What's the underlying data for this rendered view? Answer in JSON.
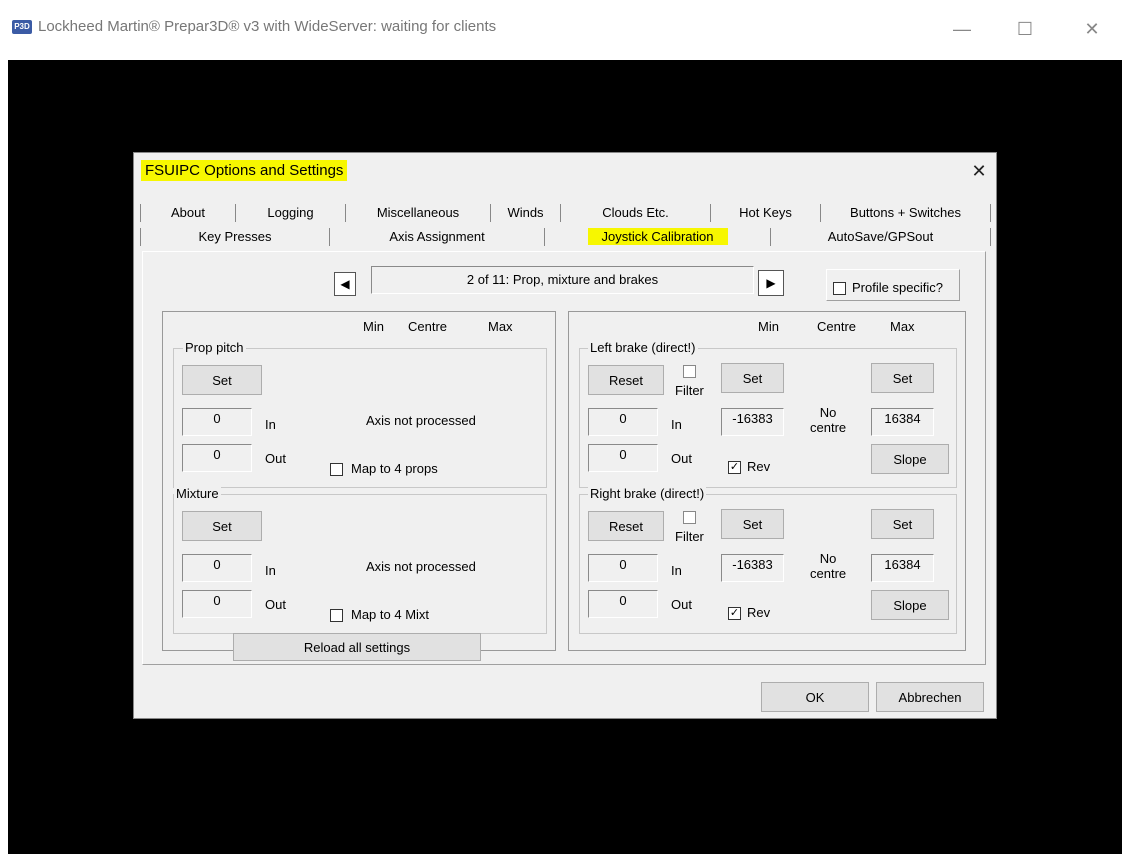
{
  "window": {
    "icon_text": "P3D",
    "title": "Lockheed Martin® Prepar3D® v3 with WideServer: waiting for clients",
    "minimize_glyph": "—",
    "maximize_glyph": "☐",
    "close_glyph": "✕"
  },
  "dialog": {
    "title": "FSUIPC Options and Settings",
    "close_glyph": "✕",
    "tabs_row1": [
      "About",
      "Logging",
      "Miscellaneous",
      "Winds",
      "Clouds Etc.",
      "Hot Keys",
      "Buttons + Switches"
    ],
    "tabs_row2": [
      "Key Presses",
      "Axis Assignment",
      "Joystick Calibration",
      "AutoSave/GPSout"
    ],
    "active_tab": "Joystick Calibration",
    "nav": {
      "prev_glyph": "◀",
      "next_glyph": "▶",
      "page_label": "2 of 11: Prop, mixture and brakes",
      "profile_specific_label": "Profile specific?",
      "profile_specific_checked": false
    },
    "column_headers": {
      "min": "Min",
      "centre": "Centre",
      "max": "Max"
    },
    "left_panel": {
      "prop_pitch": {
        "legend": "Prop pitch",
        "set_label": "Set",
        "in_value": "0",
        "in_label": "In",
        "out_value": "0",
        "out_label": "Out",
        "status": "Axis not processed",
        "map_label": "Map to 4 props",
        "map_checked": false
      },
      "mixture": {
        "legend": "Mixture",
        "set_label": "Set",
        "in_value": "0",
        "in_label": "In",
        "out_value": "0",
        "out_label": "Out",
        "status": "Axis not processed",
        "map_label": "Map to 4 Mixt",
        "map_checked": false
      },
      "reload_label": "Reload all settings"
    },
    "right_panel": {
      "left_brake": {
        "legend": "Left brake (direct!)",
        "reset_label": "Reset",
        "filter_label": "Filter",
        "filter_checked": false,
        "set_min_label": "Set",
        "set_max_label": "Set",
        "in_value": "0",
        "in_label": "In",
        "out_value": "0",
        "out_label": "Out",
        "min_value": "-16383",
        "centre_text": "No\ncentre",
        "max_value": "16384",
        "rev_label": "Rev",
        "rev_checked": true,
        "slope_label": "Slope"
      },
      "right_brake": {
        "legend": "Right brake (direct!)",
        "reset_label": "Reset",
        "filter_label": "Filter",
        "filter_checked": false,
        "set_min_label": "Set",
        "set_max_label": "Set",
        "in_value": "0",
        "in_label": "In",
        "out_value": "0",
        "out_label": "Out",
        "min_value": "-16383",
        "centre_text": "No\ncentre",
        "max_value": "16384",
        "rev_label": "Rev",
        "rev_checked": true,
        "slope_label": "Slope"
      }
    },
    "ok_label": "OK",
    "cancel_label": "Abbrechen",
    "highlight_color": "#f7f700"
  }
}
